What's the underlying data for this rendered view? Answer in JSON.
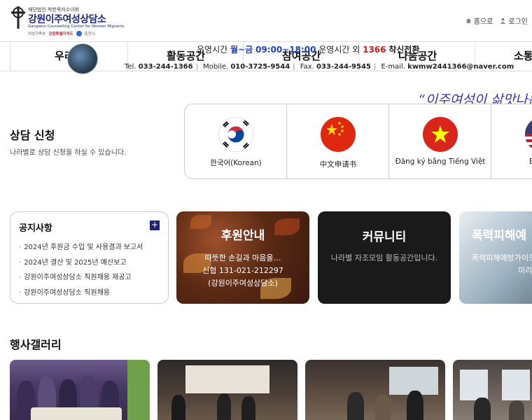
{
  "header": {
    "org_top": "재단법인 착한목자수녀회",
    "org_name": "강원이주여성상담소",
    "org_en": "Gangwon Counselling Center for Women Migrants",
    "sponsors": [
      "여성가족부",
      "강원특별자치도",
      "춘천시"
    ],
    "util": [
      {
        "icon": "home-icon",
        "label": "홈으로"
      },
      {
        "icon": "user-icon",
        "label": "로그인"
      }
    ]
  },
  "nav": {
    "menus": [
      "우리는",
      "활동공간",
      "참여공간",
      "나눔공간",
      "소통"
    ],
    "hours": {
      "prefix": "운영시간",
      "days": "월~금",
      "time": "09:00~18:00",
      "mid": "운영시간 외",
      "hotline": "1366",
      "suffix": "착신전환"
    },
    "contact": {
      "tel_label": "Tel.",
      "tel": "033-244-1366",
      "mobile_label": "Mobile.",
      "mobile": "010-3725-9544",
      "fax_label": "Fax.",
      "fax": "033-244-9545",
      "email_label": "E-mail.",
      "email": "kwmw2441366@naver.com"
    }
  },
  "consult": {
    "title": "상담 신청",
    "desc": "나라별로 상담 신청을 하실 수 있습니다.",
    "slogan": "“이주여성이 삶맛나는",
    "languages": [
      {
        "flag": "korea-flag-icon",
        "label": "한국어(Korean)"
      },
      {
        "flag": "china-flag-icon",
        "label": "中文申请书"
      },
      {
        "flag": "vietnam-flag-icon",
        "label": "Đăng ký bằng Tiếng Việt"
      },
      {
        "flag": "usa-flag-icon",
        "label": "English"
      }
    ]
  },
  "notice": {
    "title": "공지사항",
    "more": "+",
    "items": [
      "2024년 후원금 수입 및 사용결과 보고서",
      "2024년 결산 및 2025년 예산보고",
      "강원이주여성상담소 직원채용 재공고",
      "강원이주여성상담소 직원채용"
    ]
  },
  "cards": [
    {
      "title": "후원안내",
      "lines": [
        "따뜻한 손길과 마음을…",
        "신협 131-021-212297",
        "(강원이주여성상담소)"
      ]
    },
    {
      "title": "커뮤니티",
      "lines": [
        "나라별 자조모임 활동공간입니다."
      ]
    },
    {
      "title": "폭력피해예",
      "lines": [
        "폭력피해예방가이드",
        "미리 예방해"
      ]
    }
  ],
  "gallery": {
    "title": "행사갤러리"
  },
  "colors": {
    "brand": "#1e2a78",
    "hours_blue": "#1a3fbf",
    "hotline_red": "#d0161f",
    "slogan": "#3b2fbf"
  }
}
